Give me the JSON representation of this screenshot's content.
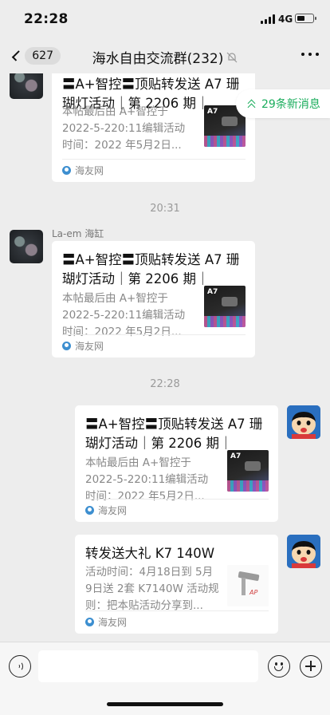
{
  "status_bar": {
    "time": "22:28",
    "network": "4G",
    "battery_level": 0.55
  },
  "nav": {
    "back_count": "627",
    "title": "海水自由交流群(232)",
    "mute_icon": "bell-slash-icon",
    "more_icon": "more-dots-icon"
  },
  "new_messages_pill": "29条新消息",
  "messages": [
    {
      "side": "left",
      "sender": "",
      "card": {
        "title": "〓A+智控〓顶贴转发送 A7 珊瑚灯活动｜第 2206 期｜",
        "desc_lines": [
          "本帖最后由 A+智控于",
          "2022-5-220:11编辑活动",
          "时间：2022 年5月2日..."
        ],
        "thumb": "A7",
        "source": "海友网"
      }
    },
    {
      "timestamp": "20:31"
    },
    {
      "side": "left",
      "sender": "La-em 海缸",
      "card": {
        "title": "〓A+智控〓顶贴转发送 A7 珊瑚灯活动｜第 2206 期｜",
        "desc_lines": [
          "本帖最后由 A+智控于",
          "2022-5-220:11编辑活动",
          "时间：2022 年5月2日..."
        ],
        "thumb": "A7",
        "source": "海友网"
      }
    },
    {
      "timestamp": "22:28"
    },
    {
      "side": "right",
      "card": {
        "title": "〓A+智控〓顶贴转发送 A7 珊瑚灯活动｜第 2206 期｜",
        "desc_lines": [
          "本帖最后由 A+智控于",
          "2022-5-220:11编辑活动",
          "时间：2022 年5月2日..."
        ],
        "thumb": "A7",
        "source": "海友网"
      }
    },
    {
      "side": "right",
      "card": {
        "title": "转发送大礼 K7 140W",
        "desc_lines": [
          "活动时间：4月18日到 5月",
          "9日送 2套 K7140W 活动规",
          "则：把本贴活动分享到..."
        ],
        "thumb": "AP",
        "source": "海友网"
      }
    }
  ],
  "input_bar": {
    "voice_icon": "voice-icon",
    "emoji_icon": "emoji-icon",
    "plus_icon": "plus-icon",
    "placeholder": ""
  },
  "colors": {
    "background": "#ededed",
    "accent_green": "#1aad5c",
    "card": "#ffffff"
  }
}
